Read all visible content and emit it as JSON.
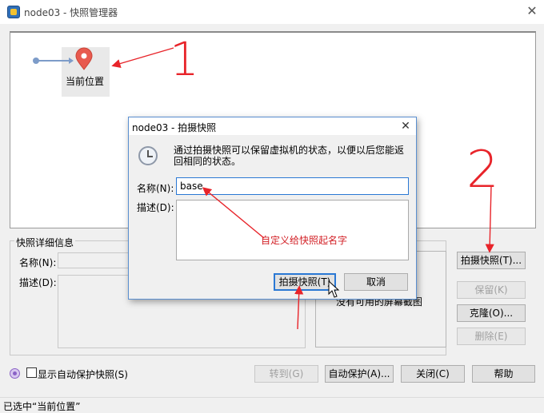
{
  "window": {
    "title": "node03 - 快照管理器"
  },
  "tree": {
    "current_state_label": "当前位置"
  },
  "details": {
    "legend": "快照详细信息",
    "name_label": "名称(N):",
    "desc_label": "描述(D):",
    "no_screenshot": "没有可用的屏幕截图"
  },
  "side_buttons": {
    "take": "拍摄快照(T)...",
    "keep": "保留(K)",
    "clone": "克隆(O)...",
    "delete": "删除(E)"
  },
  "bottom": {
    "show_autoprotect": "显示自动保护快照(S)",
    "goto": "转到(G)",
    "autoprotect": "自动保护(A)...",
    "close": "关闭(C)",
    "help": "帮助"
  },
  "status": {
    "text": "已选中“当前位置”"
  },
  "dialog": {
    "title": "node03 - 拍摄快照",
    "message": "通过拍摄快照可以保留虚拟机的状态，以便以后您能返回相同的状态。",
    "name_label": "名称(N):",
    "name_value": "base",
    "desc_label": "描述(D):",
    "take_button": "拍摄快照(T)",
    "cancel_button": "取消"
  },
  "annotations": {
    "one": "1",
    "two": "2",
    "hint": "自定义给快照起名字"
  },
  "colors": {
    "accent": "#2a78d4",
    "annotation": "#e8242a",
    "pin": "#e85a4f"
  }
}
